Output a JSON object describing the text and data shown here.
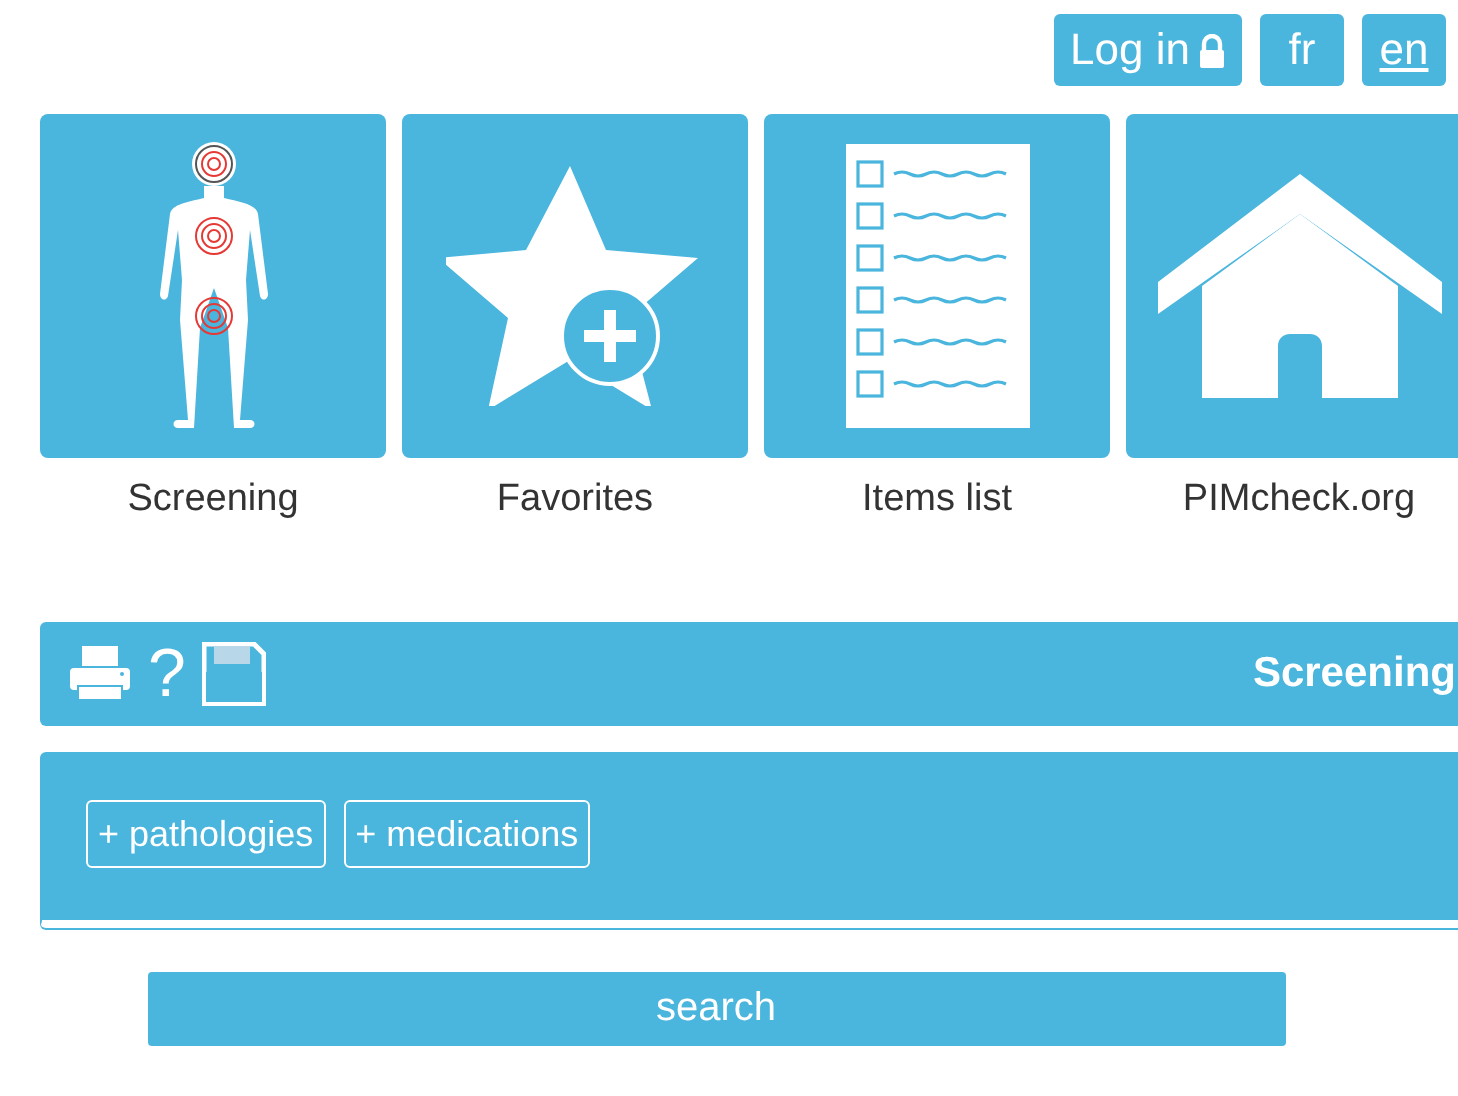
{
  "header": {
    "login": "Log in",
    "languages": [
      {
        "label": "fr",
        "selected": false
      },
      {
        "label": "en",
        "selected": true
      }
    ]
  },
  "tiles": [
    {
      "kind": "body",
      "label": "Screening"
    },
    {
      "kind": "star",
      "label": "Favorites"
    },
    {
      "kind": "list",
      "label": "Items list"
    },
    {
      "kind": "home",
      "label": "PIMcheck.org"
    }
  ],
  "toolbar": {
    "help": "?",
    "title": "Screening"
  },
  "panel": {
    "buttons": [
      "+ pathologies",
      "+ medications"
    ]
  },
  "search_button": "search"
}
